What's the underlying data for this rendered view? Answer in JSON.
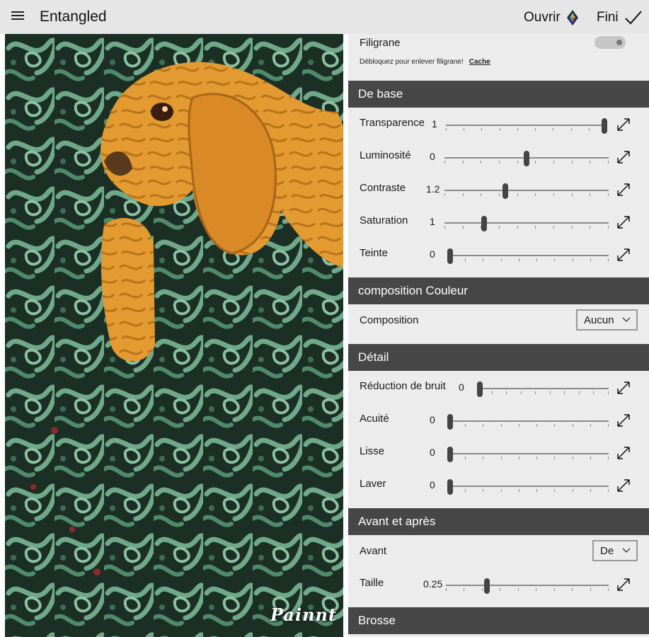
{
  "titlebar": {
    "app_title": "Entangled",
    "open_label": "Ouvrir",
    "done_label": "Fini"
  },
  "canvas": {
    "watermark_text": "Painnt"
  },
  "watermark": {
    "title": "Filigrane",
    "note": "Débloquez pour enlever filigrane!",
    "link": "Cache",
    "toggle_on": false
  },
  "sections": {
    "basic": "De base",
    "color_comp": "composition Couleur",
    "detail": "Détail",
    "before_after": "Avant et après",
    "brush": "Brosse"
  },
  "sliders": {
    "transparence": {
      "label": "Transparence",
      "value": "1",
      "position": 1.0
    },
    "luminosite": {
      "label": "Luminosité",
      "value": "0",
      "position": 0.5
    },
    "contraste": {
      "label": "Contraste",
      "value": "1.2",
      "position": 0.37
    },
    "saturation": {
      "label": "Saturation",
      "value": "1",
      "position": 0.24
    },
    "teinte": {
      "label": "Teinte",
      "value": "0",
      "position": 0.0
    },
    "reduction": {
      "label": "Réduction de bruit",
      "value": "0",
      "position": 0.0
    },
    "acuite": {
      "label": "Acuité",
      "value": "0",
      "position": 0.0
    },
    "lisse": {
      "label": "Lisse",
      "value": "0",
      "position": 0.0
    },
    "laver": {
      "label": "Laver",
      "value": "0",
      "position": 0.0
    },
    "taille": {
      "label": "Taille",
      "value": "0.25",
      "position": 0.25
    }
  },
  "composition": {
    "label": "Composition",
    "selected": "Aucun"
  },
  "avant": {
    "label": "Avant",
    "selected": "De"
  },
  "icons": {
    "menu": "hamburger-icon",
    "open": "diamond-icon",
    "done": "checkmark-icon",
    "expand": "expand-arrows-icon"
  },
  "colors": {
    "section_header": "#474747",
    "panel_bg": "#ececec",
    "titlebar_bg": "#e6e6e6",
    "canvas_green": "#5c9a7a",
    "canvas_orange": "#e9a33c"
  }
}
